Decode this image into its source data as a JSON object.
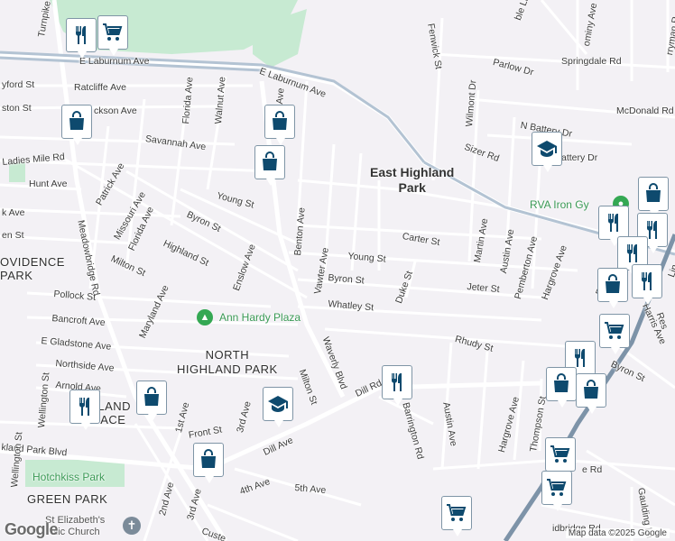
{
  "map": {
    "attribution": "Map data ©2025 Google",
    "logo": "Google",
    "colors": {
      "background": "#f3f1f5",
      "park": "#c7ead2",
      "road": "#ffffff",
      "highway": "#b3c3d3",
      "pin_icon": "#0e4a6e",
      "rail": "#7d93a8"
    },
    "areas": [
      {
        "id": "east-highland-park",
        "text": "East Highland\nPark"
      },
      {
        "id": "north-highland-park",
        "text": "NORTH\nHIGHLAND PARK"
      },
      {
        "id": "providence-park",
        "text": "OVIDENCE\nPARK"
      },
      {
        "id": "highland-terrace",
        "text": "HI   LAND\nTE   ACE"
      },
      {
        "id": "green-park",
        "text": "GREEN PARK"
      }
    ],
    "pois": [
      {
        "id": "ann-hardy-plaza",
        "text": "Ann Hardy Plaza"
      },
      {
        "id": "rva-iron-gym",
        "text": "RVA Iron Gy"
      },
      {
        "id": "hotchkiss-park",
        "text": "Hotchkiss Park"
      },
      {
        "id": "st-elizabeths",
        "text": "St Elizabeth's\nolic Church"
      }
    ],
    "streets": [
      "Turnpike",
      "E Laburnum Ave",
      "E Laburnum Ave",
      "Fenwick St",
      "Parlow Dr",
      "Springdale Rd",
      "McDonald Rd",
      "Ratcliffe Ave",
      "Florida Ave",
      "Walnut Ave",
      "Wilmont Dr",
      "N Battery Dr",
      "ckson Ave",
      "ston St",
      "yford St",
      "Savannah Ave",
      "Ladies Mile Rd",
      "Hunt Ave",
      "Patrick Ave",
      "Missouri Ave",
      "Young St",
      "Sizer Rd",
      "attery Dr",
      "Benton Ave",
      "Vawter Ave",
      "Young St",
      "Carter St",
      "Byron St",
      "Byron St",
      "Florida Ave",
      "Highland St",
      "Enslow Ave",
      "Milton St",
      "Meadowbridge Rd",
      "Pollock St",
      "Bancroft Ave",
      "Maryland Ave",
      "Whatley St",
      "Duke St",
      "Jeter St",
      "Martin Ave",
      "Austin Ave",
      "Pemberton Ave",
      "Hargrove Ave",
      "Rhudy St",
      "E Gladstone Ave",
      "Northside Ave",
      "Arnold Ave",
      "Wellington St",
      "Waverly Blvd",
      "Milton St",
      "Dill Rd",
      "Barrington Rd",
      "Austin Ave",
      "Hargrove Ave",
      "Thompson St",
      "Byron St",
      "1st Ave",
      "3rd Ave",
      "Front St",
      "Dill Ave",
      "kland Park Blvd",
      "Wellington St",
      "4th Ave",
      "5th Ave",
      "2nd Ave",
      "3rd Ave",
      "Custe",
      "Gaulding Ln",
      "e Rd",
      "Harris Ave",
      "Res",
      "Lin",
      "Ro",
      "k Ave",
      "en St",
      "ominy Ave",
      "rryman R",
      "ble Ln",
      "idbridge Rd",
      "Ave"
    ]
  }
}
